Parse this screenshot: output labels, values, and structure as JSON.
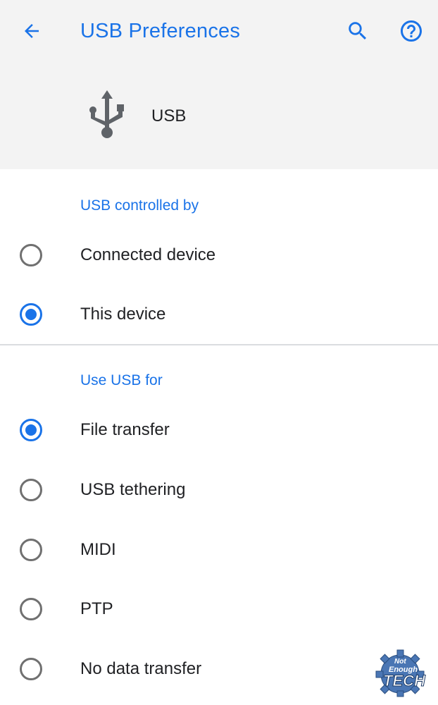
{
  "header": {
    "title": "USB Preferences",
    "back_icon": "arrow-back-icon",
    "search_icon": "search-icon",
    "help_icon": "help-circle-icon",
    "device_icon": "usb-icon",
    "device_label": "USB"
  },
  "controlled_by": {
    "title": "USB controlled by",
    "options": [
      {
        "label": "Connected device",
        "selected": false
      },
      {
        "label": "This device",
        "selected": true
      }
    ]
  },
  "use_usb_for": {
    "title": "Use USB for",
    "options": [
      {
        "label": "File transfer",
        "selected": true
      },
      {
        "label": "USB tethering",
        "selected": false
      },
      {
        "label": "MIDI",
        "selected": false
      },
      {
        "label": "PTP",
        "selected": false
      },
      {
        "label": "No data transfer",
        "selected": false
      }
    ]
  },
  "watermark": {
    "line1": "Not",
    "line2": "Enough",
    "line3": "TECH",
    "suffix": ".com"
  },
  "colors": {
    "accent": "#1a73e8",
    "header_bg": "#f3f3f3",
    "text": "#202124",
    "icon": "#5f6368",
    "radio_off": "#707070"
  }
}
